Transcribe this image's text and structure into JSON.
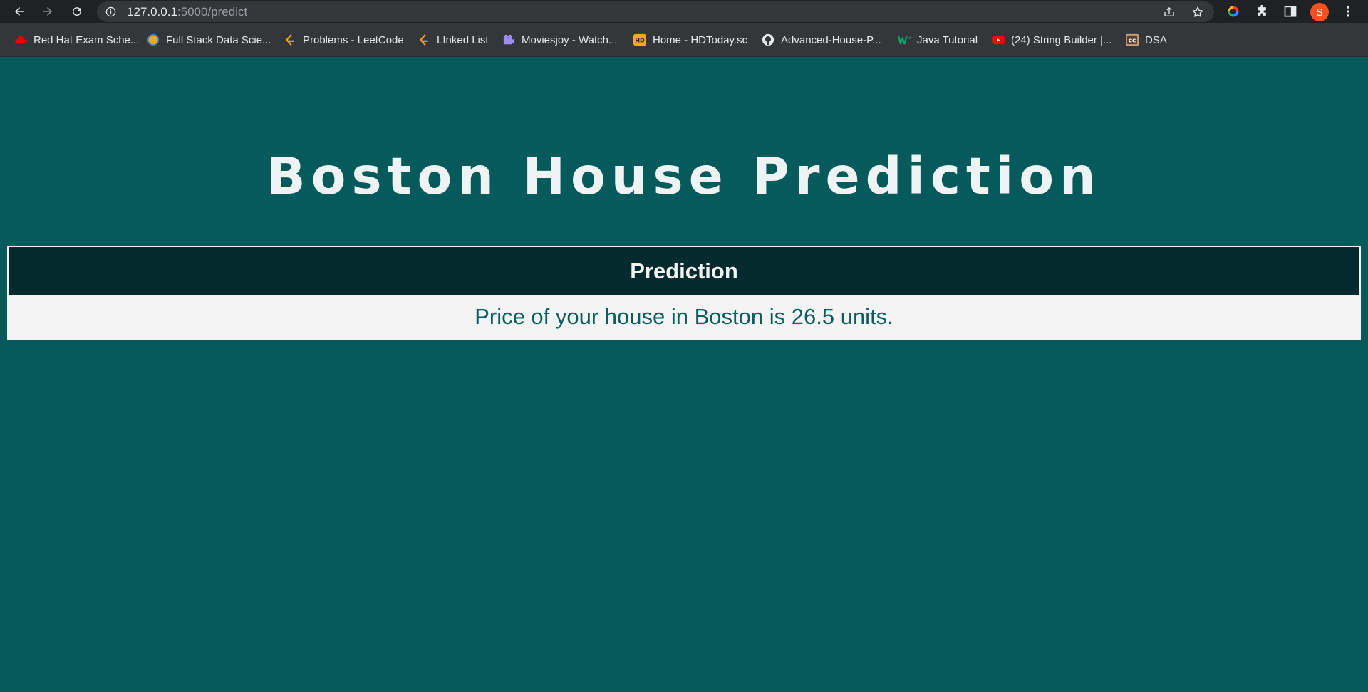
{
  "browser": {
    "url_host": "127.0.0.1",
    "url_path": ":5000/predict",
    "profile_initial": "S"
  },
  "bookmarks": [
    {
      "label": "Red Hat Exam Sche...",
      "icon": "redhat-icon"
    },
    {
      "label": "Full Stack Data Scie...",
      "icon": "globe-icon"
    },
    {
      "label": "Problems - LeetCode",
      "icon": "leetcode-icon"
    },
    {
      "label": "LInked List",
      "icon": "leetcode-icon"
    },
    {
      "label": "Moviesjoy - Watch...",
      "icon": "film-icon"
    },
    {
      "label": "Home - HDToday.sc",
      "icon": "hd-icon"
    },
    {
      "label": "Advanced-House-P...",
      "icon": "github-icon"
    },
    {
      "label": "Java Tutorial",
      "icon": "w3schools-icon"
    },
    {
      "label": "(24) String Builder |...",
      "icon": "youtube-icon"
    },
    {
      "label": "DSA",
      "icon": "cc-icon"
    }
  ],
  "page": {
    "title": "Boston House Prediction",
    "table_header": "Prediction",
    "result_text": "Price of your house in Boston is 26.5 units."
  },
  "colors": {
    "page_bg": "#065a5c",
    "header_bg": "#052a2e",
    "result_text": "#0b5d60",
    "chrome_bg": "#202124"
  }
}
